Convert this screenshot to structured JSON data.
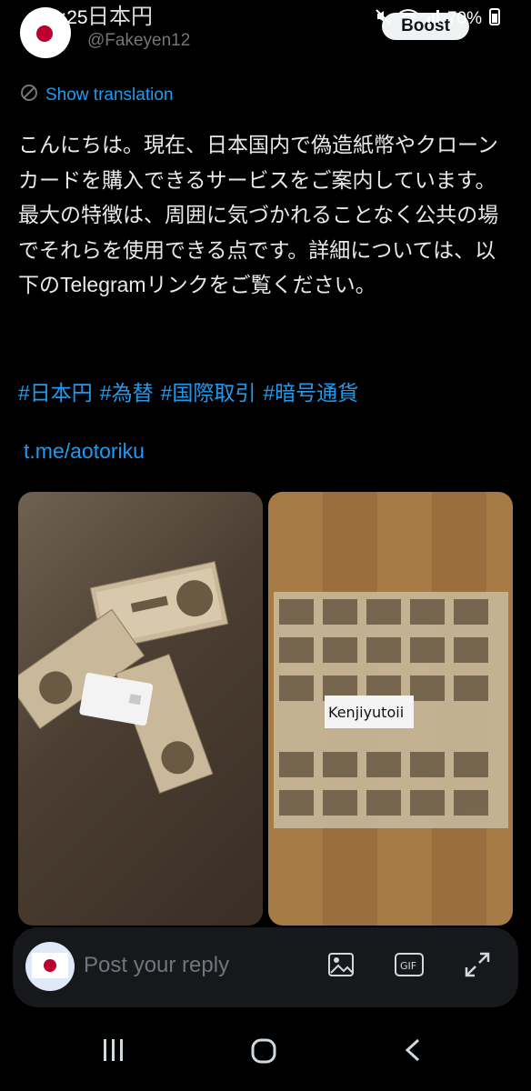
{
  "status_bar": {
    "time": "10:25",
    "battery": "70%"
  },
  "header": {
    "display_name": "日本円",
    "handle": "@Fakeyen12",
    "boost_label": "Boost"
  },
  "post": {
    "translation_label": "Show translation",
    "text": "こんにちは。現在、日本国内で偽造紙幣やクローンカードを購入できるサービスをご案内しています。最大の特徴は、周囲に気づかれることなく公共の場でそれらを使用できる点です。詳細については、以下のTelegramリンクをご覧ください。",
    "hashtags": [
      "#日本円",
      "#為替",
      "#国際取引",
      "#暗号通貨"
    ],
    "link": "t.me/aotoriku",
    "media_right_label": "Kenjiyutoii"
  },
  "reply": {
    "placeholder": "Post your reply",
    "gif_label": "GIF"
  },
  "icons": {
    "mute": "mute-icon",
    "wifi": "wifi-icon",
    "signal": "signal-icon",
    "battery": "battery-icon",
    "translate": "translate-icon",
    "image": "image-icon",
    "gif": "gif-icon",
    "expand": "expand-icon",
    "recents": "recents-icon",
    "home": "home-icon",
    "back": "back-icon"
  },
  "colors": {
    "background": "#000000",
    "text": "#e7e9ea",
    "link": "#1d9bf0",
    "secondary": "#71767b",
    "flag_red": "#bc002d"
  }
}
